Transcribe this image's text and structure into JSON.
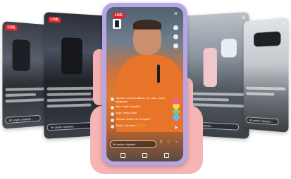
{
  "phone": {
    "live_badge": "LIVE",
    "close_glyph": "×",
    "input_placeholder": "Bir şeyler söyleyin...",
    "comments": [
      {
        "user": "Takmak",
        "text": "Ürünün kullanımı çok rahat, yorum bekliyorum"
      },
      {
        "user": "Mert",
        "text": "Fiyatı ne kadar?"
      },
      {
        "user": "Ayşe",
        "text": "Harika ürün!"
      },
      {
        "user": "Takmak",
        "text": "İndirim var mı bugün?"
      },
      {
        "user": "Burak",
        "text": "Çok güzel 😍😍😍"
      }
    ],
    "send_glyph": "➤",
    "actions": [
      "⇪",
      "♡",
      "⋯"
    ],
    "reaction_colors": [
      "#f06292",
      "#ffd54f",
      "#81c784",
      "#64b5f6"
    ]
  },
  "cards": {
    "live_badge": "LIVE",
    "close_glyph": "×",
    "input_placeholder": "Bir şeyler söyleyin..."
  },
  "colors": {
    "phone_frame": "#b7a6e6",
    "hand": "#f6b4b4",
    "live_red": "#e3242b",
    "orange_shirt": "#e8742a"
  }
}
